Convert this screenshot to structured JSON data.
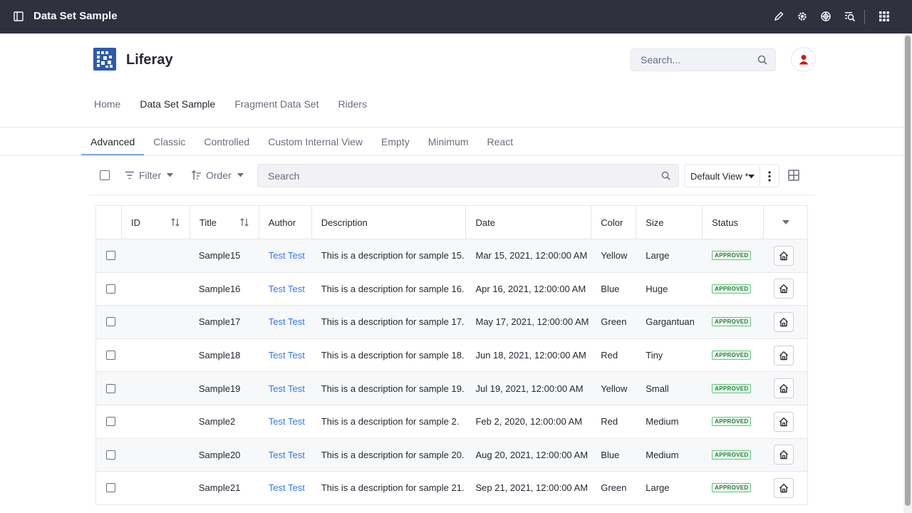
{
  "topbar": {
    "title": "Data Set Sample",
    "icons": [
      "sidebar-toggle-icon",
      "pencil-icon",
      "gear-icon",
      "simulation-icon",
      "preview-search-icon",
      "apps-grid-icon"
    ]
  },
  "site": {
    "name": "Liferay",
    "search_placeholder": "Search...",
    "nav": [
      "Home",
      "Data Set Sample",
      "Fragment Data Set",
      "Riders"
    ],
    "nav_active": "Data Set Sample"
  },
  "tabs": {
    "items": [
      "Advanced",
      "Classic",
      "Controlled",
      "Custom Internal View",
      "Empty",
      "Minimum",
      "React"
    ],
    "active": "Advanced"
  },
  "toolbar": {
    "filter_label": "Filter",
    "order_label": "Order",
    "search_placeholder": "Search",
    "view_label": "Default View *"
  },
  "table": {
    "columns": {
      "id": "ID",
      "title": "Title",
      "author": "Author",
      "description": "Description",
      "date": "Date",
      "color": "Color",
      "size": "Size",
      "status": "Status"
    },
    "rows": [
      {
        "id": "",
        "title": "Sample15",
        "author": "Test Test",
        "description": "This is a description for sample 15.",
        "date": "Mar 15, 2021, 12:00:00 AM",
        "color": "Yellow",
        "size": "Large",
        "status": "APPROVED"
      },
      {
        "id": "",
        "title": "Sample16",
        "author": "Test Test",
        "description": "This is a description for sample 16.",
        "date": "Apr 16, 2021, 12:00:00 AM",
        "color": "Blue",
        "size": "Huge",
        "status": "APPROVED"
      },
      {
        "id": "",
        "title": "Sample17",
        "author": "Test Test",
        "description": "This is a description for sample 17.",
        "date": "May 17, 2021, 12:00:00 AM",
        "color": "Green",
        "size": "Gargantuan",
        "status": "APPROVED"
      },
      {
        "id": "",
        "title": "Sample18",
        "author": "Test Test",
        "description": "This is a description for sample 18.",
        "date": "Jun 18, 2021, 12:00:00 AM",
        "color": "Red",
        "size": "Tiny",
        "status": "APPROVED"
      },
      {
        "id": "",
        "title": "Sample19",
        "author": "Test Test",
        "description": "This is a description for sample 19.",
        "date": "Jul 19, 2021, 12:00:00 AM",
        "color": "Yellow",
        "size": "Small",
        "status": "APPROVED"
      },
      {
        "id": "",
        "title": "Sample2",
        "author": "Test Test",
        "description": "This is a description for sample 2.",
        "date": "Feb 2, 2020, 12:00:00 AM",
        "color": "Red",
        "size": "Medium",
        "status": "APPROVED"
      },
      {
        "id": "",
        "title": "Sample20",
        "author": "Test Test",
        "description": "This is a description for sample 20.",
        "date": "Aug 20, 2021, 12:00:00 AM",
        "color": "Blue",
        "size": "Medium",
        "status": "APPROVED"
      },
      {
        "id": "",
        "title": "Sample21",
        "author": "Test Test",
        "description": "This is a description for sample 21.",
        "date": "Sep 21, 2021, 12:00:00 AM",
        "color": "Green",
        "size": "Large",
        "status": "APPROVED"
      }
    ]
  },
  "colors": {
    "topbar_bg": "#30313f",
    "brand_blue": "#0b5fff",
    "logo_blue": "#2e5aac",
    "avatar_red": "#da1414",
    "approved_green": "#287d3c"
  }
}
